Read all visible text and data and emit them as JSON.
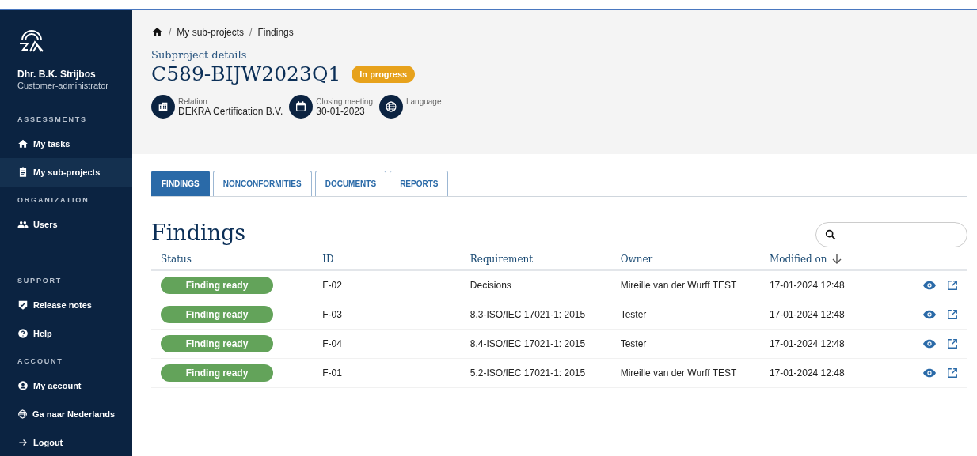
{
  "sidebar": {
    "user_name": "Dhr. B.K. Strijbos",
    "user_role": "Customer-administrator",
    "sections": [
      {
        "heading": "ASSESSMENTS",
        "items": [
          {
            "label": "My tasks",
            "selected": false
          },
          {
            "label": "My sub-projects",
            "selected": true
          }
        ]
      },
      {
        "heading": "ORGANIZATION",
        "items": [
          {
            "label": "Users",
            "selected": false
          }
        ]
      },
      {
        "heading": "SUPPORT",
        "items": [
          {
            "label": "Release notes",
            "selected": false
          },
          {
            "label": "Help",
            "selected": false
          }
        ]
      },
      {
        "heading": "ACCOUNT",
        "items": [
          {
            "label": "My account",
            "selected": false
          },
          {
            "label": "Ga naar Nederlands",
            "selected": false
          },
          {
            "label": "Logout",
            "selected": false
          }
        ]
      }
    ]
  },
  "breadcrumb": [
    {
      "separator": "/",
      "label": "My sub-projects"
    },
    {
      "separator": "/",
      "label": "Findings"
    }
  ],
  "header": {
    "subtitle": "Subproject details",
    "title": "C589-BIJW2023Q1",
    "status": "In progress",
    "meta": [
      {
        "label": "Relation",
        "value": "DEKRA Certification B.V."
      },
      {
        "label": "Closing meeting",
        "value": "30-01-2023"
      },
      {
        "label": "Language"
      }
    ]
  },
  "tabs": [
    {
      "label": "FINDINGS",
      "selected": true
    },
    {
      "label": "NONCONFORMITIES",
      "selected": false
    },
    {
      "label": "DOCUMENTS",
      "selected": false
    },
    {
      "label": "REPORTS",
      "selected": false
    }
  ],
  "section_title": "Findings",
  "table": {
    "columns": [
      {
        "label": "Status"
      },
      {
        "label": "ID"
      },
      {
        "label": "Requirement"
      },
      {
        "label": "Owner"
      },
      {
        "label": "Modified on",
        "sorted": true
      }
    ],
    "rows": [
      {
        "status": "Finding ready",
        "id": "F-02",
        "requirement": "Decisions",
        "owner": "Mireille van der Wurff TEST",
        "modified": "17-01-2024 12:48"
      },
      {
        "status": "Finding ready",
        "id": "F-03",
        "requirement": "8.3-ISO/IEC 17021-1: 2015",
        "owner": "Tester",
        "modified": "17-01-2024 12:48"
      },
      {
        "status": "Finding ready",
        "id": "F-04",
        "requirement": "8.4-ISO/IEC 17021-1: 2015",
        "owner": "Tester",
        "modified": "17-01-2024 12:48"
      },
      {
        "status": "Finding ready",
        "id": "F-01",
        "requirement": "5.2-ISO/IEC 17021-1: 2015",
        "owner": "Mireille van der Wurff TEST",
        "modified": "17-01-2024 12:48"
      }
    ]
  }
}
